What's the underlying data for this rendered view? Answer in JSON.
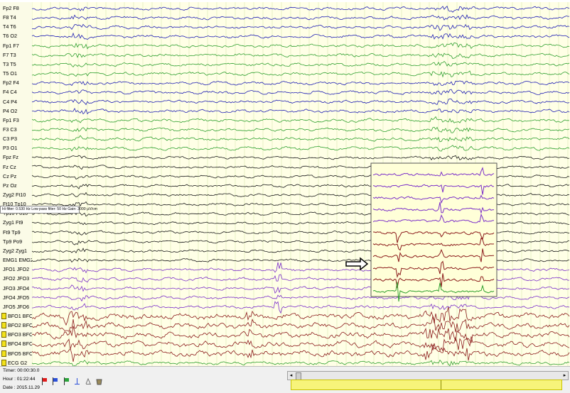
{
  "channels": [
    {
      "label": "Fp2 F8",
      "color": "#1f1fb4",
      "warning": false
    },
    {
      "label": "F8 T4",
      "color": "#1f1fb4",
      "warning": false
    },
    {
      "label": "T4 T6",
      "color": "#1f1fb4",
      "warning": false
    },
    {
      "label": "T6 O2",
      "color": "#1f1fb4",
      "warning": false
    },
    {
      "label": "Fp1 F7",
      "color": "#2fa02f",
      "warning": false
    },
    {
      "label": "F7 T3",
      "color": "#2fa02f",
      "warning": false
    },
    {
      "label": "T3 T5",
      "color": "#2fa02f",
      "warning": false
    },
    {
      "label": "T5 O1",
      "color": "#2fa02f",
      "warning": false
    },
    {
      "label": "Fp2 F4",
      "color": "#1f1fb4",
      "warning": false
    },
    {
      "label": "F4 C4",
      "color": "#1f1fb4",
      "warning": false
    },
    {
      "label": "C4 P4",
      "color": "#1f1fb4",
      "warning": false
    },
    {
      "label": "P4 O2",
      "color": "#1f1fb4",
      "warning": false
    },
    {
      "label": "Fp1 F3",
      "color": "#2fa02f",
      "warning": false
    },
    {
      "label": "F3 C3",
      "color": "#2fa02f",
      "warning": false
    },
    {
      "label": "C3 P3",
      "color": "#2fa02f",
      "warning": false
    },
    {
      "label": "P3 O1",
      "color": "#2fa02f",
      "warning": false
    },
    {
      "label": "Fpz Fz",
      "color": "#1a1a1a",
      "warning": false
    },
    {
      "label": "Fz Cz",
      "color": "#1a1a1a",
      "warning": false
    },
    {
      "label": "Cz Pz",
      "color": "#1a1a1a",
      "warning": false
    },
    {
      "label": "Pz Oz",
      "color": "#1a1a1a",
      "warning": false
    },
    {
      "label": "Zyg2 Ft10",
      "color": "#1a1a1a",
      "warning": false
    },
    {
      "label": "Ft10 Tp10",
      "color": "#1a1a1a",
      "warning": false
    },
    {
      "label": "Tp10 Po10",
      "color": "#1a1a1a",
      "warning": false
    },
    {
      "label": "Zyg1 Ft9",
      "color": "#1a1a1a",
      "warning": false
    },
    {
      "label": "Ft9 Tp9",
      "color": "#1a1a1a",
      "warning": false
    },
    {
      "label": "Tp9 Po9",
      "color": "#1a1a1a",
      "warning": false
    },
    {
      "label": "Zyg2 Zyg1",
      "color": "#1a1a1a",
      "warning": false
    },
    {
      "label": "EMG1 EMG2",
      "color": "#1a1a1a",
      "warning": false
    },
    {
      "label": "JFO1 JFO2",
      "color": "#7b2fc9",
      "warning": false
    },
    {
      "label": "JFO2 JFO3",
      "color": "#7b2fc9",
      "warning": false
    },
    {
      "label": "JFO3 JFO4",
      "color": "#7b2fc9",
      "warning": false
    },
    {
      "label": "JFO4 JFO5",
      "color": "#7b2fc9",
      "warning": false
    },
    {
      "label": "JFO5 JFO6",
      "color": "#7b2fc9",
      "warning": false
    },
    {
      "label": "BFO1 BFO2",
      "color": "#8b1a1a",
      "warning": true
    },
    {
      "label": "BFO2 BFO3",
      "color": "#8b1a1a",
      "warning": true
    },
    {
      "label": "BFO3 BFO4",
      "color": "#8b1a1a",
      "warning": true
    },
    {
      "label": "BFO4 BFO5",
      "color": "#8b1a1a",
      "warning": true
    },
    {
      "label": "BFO5 BFO6",
      "color": "#8b1a1a",
      "warning": true
    },
    {
      "label": "ECG G2",
      "color": "#2fa02f",
      "warning": true
    }
  ],
  "filter_info": "Hi filter: 0.530 Hz   Low pass filter: 50 Hz   Gain: 3000 µV/cm",
  "status": {
    "timer": "Timer: 00:00:30.0",
    "hour": "Hour : 01:22:44",
    "date": "Date : 2015.11.29"
  },
  "toolbar_icons": [
    "flag-red-icon",
    "flag-blue-icon",
    "flag-green-icon",
    "marker-icon",
    "measure-icon",
    "bucket-icon"
  ],
  "colors": {
    "trace_bg": "#ffffe6",
    "label_bg": "#fbfbe7",
    "timeline": "#f7f47a"
  }
}
